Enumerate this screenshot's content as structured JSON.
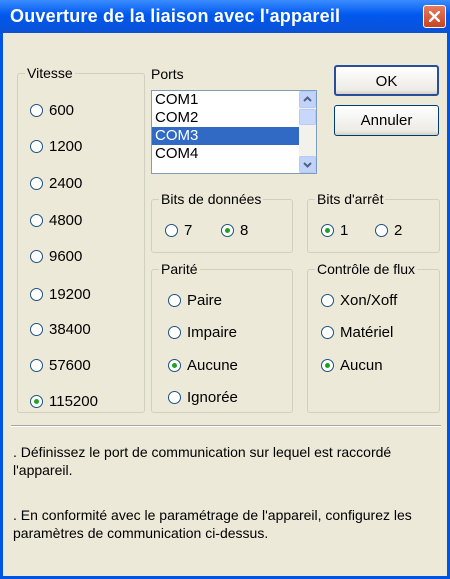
{
  "window": {
    "title": "Ouverture de la liaison avec l'appareil"
  },
  "colors": {
    "titlebar": "#0058EE",
    "face": "#ECE9D8",
    "selection": "#316AC5",
    "radio_dot": "#21A121"
  },
  "icons": {
    "close": "close-icon",
    "scroll_up": "chevron-up-icon",
    "scroll_down": "chevron-down-icon"
  },
  "speed": {
    "legend": "Vitesse",
    "options": [
      "600",
      "1200",
      "2400",
      "4800",
      "9600",
      "19200",
      "38400",
      "57600",
      "115200"
    ],
    "selected": "115200"
  },
  "ports": {
    "label": "Ports",
    "items": [
      "COM1",
      "COM2",
      "COM3",
      "COM4"
    ],
    "selected": "COM3"
  },
  "buttons": {
    "ok": "OK",
    "cancel": "Annuler"
  },
  "data_bits": {
    "legend": "Bits de données",
    "options": [
      "7",
      "8"
    ],
    "selected": "8"
  },
  "stop_bits": {
    "legend": "Bits d'arrêt",
    "options": [
      "1",
      "2"
    ],
    "selected": "1"
  },
  "parity": {
    "legend": "Parité",
    "options": [
      "Paire",
      "Impaire",
      "Aucune",
      "Ignorée"
    ],
    "selected": "Aucune"
  },
  "flow_control": {
    "legend": "Contrôle de flux",
    "options": [
      "Xon/Xoff",
      "Matériel",
      "Aucun"
    ],
    "selected": "Aucun"
  },
  "info": {
    "line1": ". Définissez le port de communication sur lequel est raccordé l'appareil.",
    "line2": ". En conformité avec le paramétrage de l'appareil, configurez les paramètres de communication ci-dessus."
  }
}
